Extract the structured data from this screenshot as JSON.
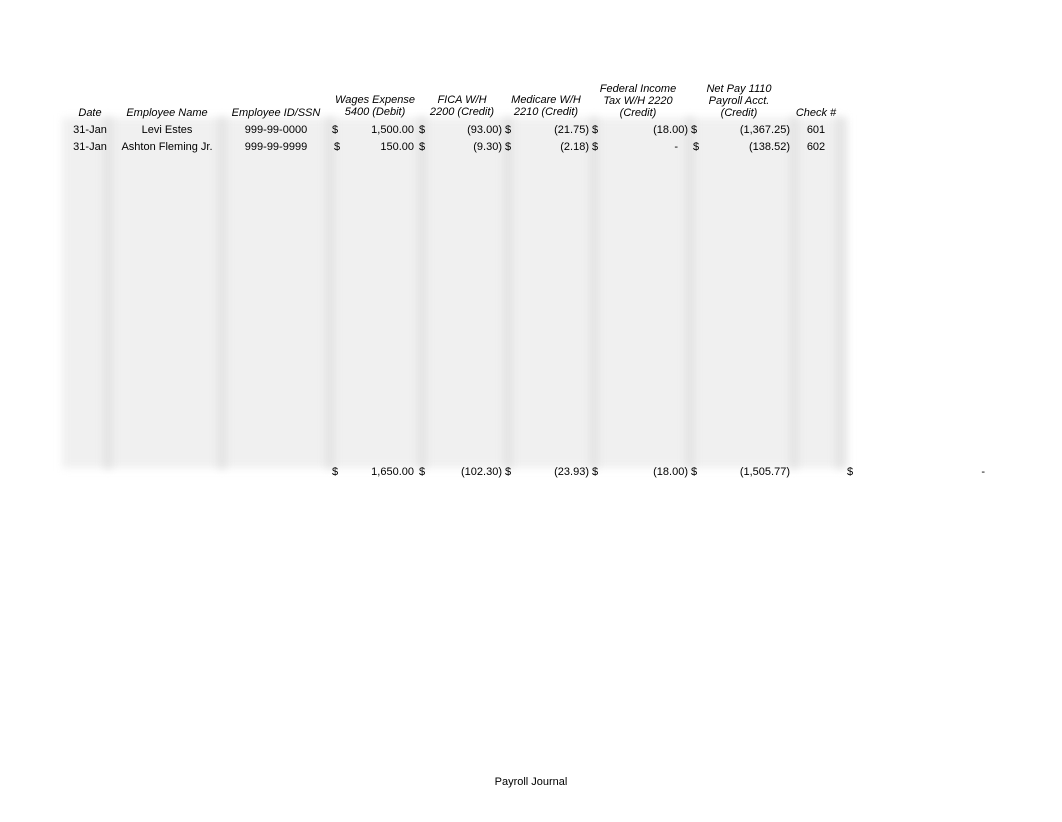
{
  "sheet": {
    "headers": {
      "date": "Date",
      "employee_name": "Employee Name",
      "employee_id": "Employee ID/SSN",
      "wages": [
        "Wages Expense",
        "5400 (Debit)"
      ],
      "fica": [
        "FICA W/H",
        "2200 (Credit)"
      ],
      "medicare": [
        "Medicare W/H",
        "2210 (Credit)"
      ],
      "fed_tax": [
        "Federal Income",
        "Tax W/H 2220",
        "(Credit)"
      ],
      "net_pay": [
        "Net Pay 1110",
        "Payroll Acct.",
        "(Credit)"
      ],
      "check": "Check #"
    },
    "rows": [
      {
        "date": "31-Jan",
        "name": "Levi Estes",
        "id": "999-99-0000",
        "wages": "1,500.00",
        "fica": "(93.00)",
        "medicare": "(21.75)",
        "fed_tax": "(18.00)",
        "net_pay": "(1,367.25)",
        "check": "601"
      },
      {
        "date": "31-Jan",
        "name": "Ashton Fleming Jr.",
        "id": "999-99-9999",
        "wages": "150.00",
        "fica": "(9.30)",
        "medicare": "(2.18)",
        "fed_tax": "-",
        "net_pay": "(138.52)",
        "check": "602"
      }
    ],
    "totals": {
      "wages": "1,650.00",
      "fica": "(102.30)",
      "medicare": "(23.93)",
      "fed_tax": "(18.00)",
      "net_pay": "(1,505.77)",
      "extra": "-"
    },
    "currency_symbol": "$"
  },
  "footer": {
    "sheet_name": "Payroll Journal"
  }
}
